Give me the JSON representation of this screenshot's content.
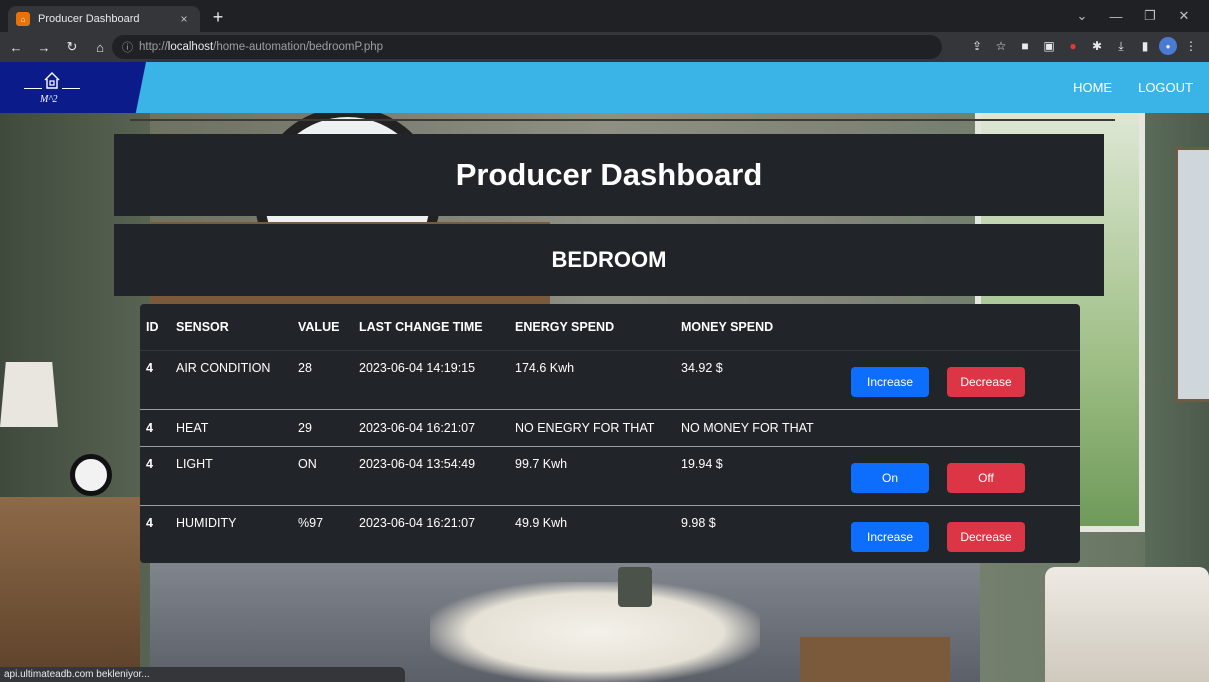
{
  "browser": {
    "tab_title": "Producer Dashboard",
    "tab_close": "×",
    "new_tab": "+",
    "url_scheme": "http://",
    "url_host": "localhost",
    "url_path": "/home-automation/bedroomP.php",
    "status_text": "api.ultimateadb.com bekleniyor..."
  },
  "navbar": {
    "logo_text": "M^2",
    "home": "HOME",
    "logout": "LOGOUT"
  },
  "page": {
    "title": "Producer Dashboard",
    "room": "BEDROOM"
  },
  "table": {
    "headers": [
      "ID",
      "SENSOR",
      "VALUE",
      "LAST CHANGE TIME",
      "ENERGY SPEND",
      "MONEY SPEND"
    ],
    "rows": [
      {
        "id": "4",
        "sensor": "AIR CONDITION",
        "value": "28",
        "time": "2023-06-04 14:19:15",
        "energy": "174.6 Kwh",
        "money": "34.92 $",
        "btn1": "Increase",
        "btn2": "Decrease"
      },
      {
        "id": "4",
        "sensor": "HEAT",
        "value": "29",
        "time": "2023-06-04 16:21:07",
        "energy": "NO ENEGRY FOR THAT",
        "money": "NO MONEY FOR THAT"
      },
      {
        "id": "4",
        "sensor": "LIGHT",
        "value": "ON",
        "time": "2023-06-04 13:54:49",
        "energy": "99.7 Kwh",
        "money": "19.94 $",
        "btn1": "On",
        "btn2": "Off"
      },
      {
        "id": "4",
        "sensor": "HUMIDITY",
        "value": "%97",
        "time": "2023-06-04 16:21:07",
        "energy": "49.9 Kwh",
        "money": "9.98 $",
        "btn1": "Increase",
        "btn2": "Decrease"
      }
    ]
  },
  "colors": {
    "navbar": "#3ab4e6",
    "logo_bg": "#0b1b8a",
    "panel_bg": "#212529",
    "btn_primary": "#0d6efd",
    "btn_danger": "#dc3545"
  }
}
